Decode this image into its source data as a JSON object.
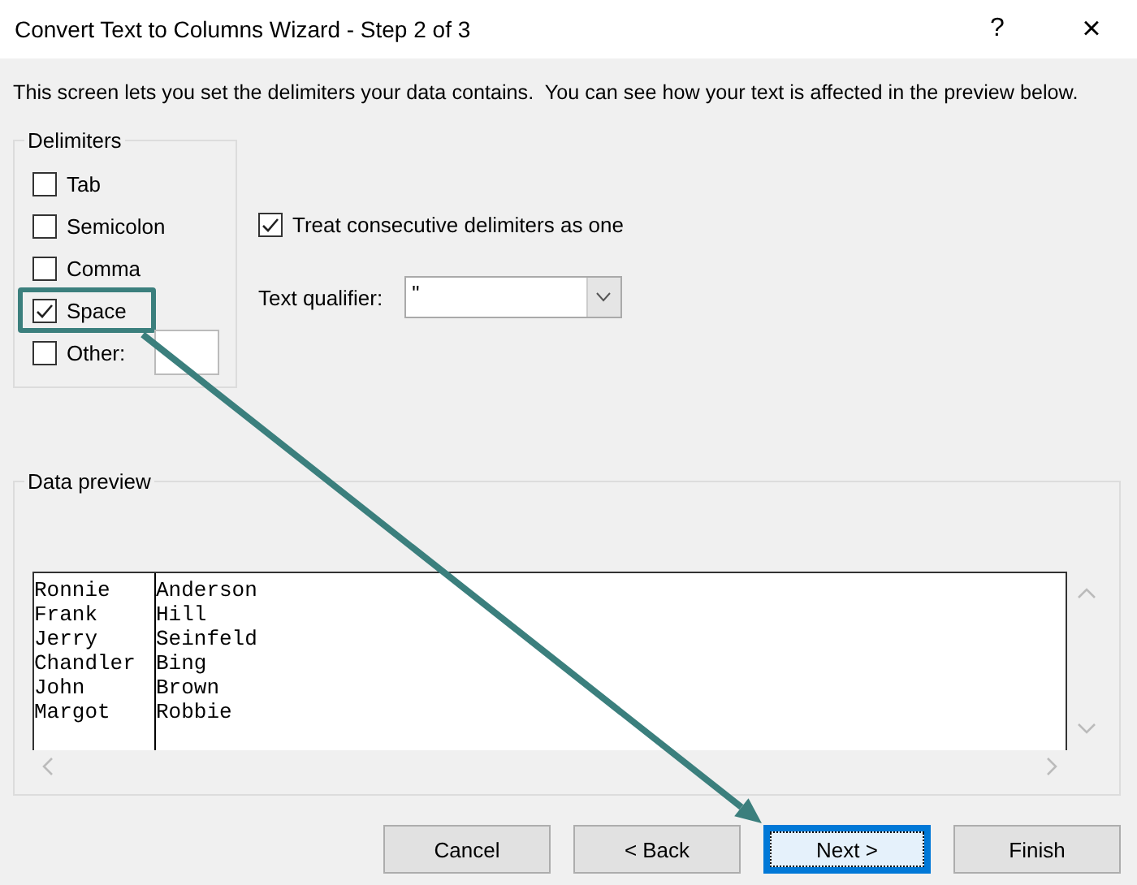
{
  "window": {
    "title": "Convert Text to Columns Wizard - Step 2 of 3",
    "help": "?",
    "close": "×"
  },
  "description": "This screen lets you set the delimiters your data contains.  You can see how your text is affected in the preview below.",
  "delimiters": {
    "title": "Delimiters",
    "items": [
      {
        "kind": "check",
        "label": "Tab",
        "checked": false,
        "highlighted": false
      },
      {
        "kind": "check",
        "label": "Semicolon",
        "checked": false,
        "highlighted": false
      },
      {
        "kind": "check",
        "label": "Comma",
        "checked": false,
        "highlighted": false
      },
      {
        "kind": "check",
        "label": "Space",
        "checked": true,
        "highlighted": true
      },
      {
        "kind": "other",
        "label": "Other:",
        "checked": false,
        "highlighted": false
      }
    ]
  },
  "consecutive": {
    "label": "Treat consecutive delimiters as one",
    "checked": true
  },
  "text_qualifier": {
    "label": "Text qualifier:",
    "value": "\""
  },
  "preview": {
    "title": "Data preview",
    "rows": [
      [
        "Ronnie",
        "Anderson"
      ],
      [
        "Frank",
        "Hill"
      ],
      [
        "Jerry",
        "Seinfeld"
      ],
      [
        "Chandler",
        "Bing"
      ],
      [
        "John",
        "Brown"
      ],
      [
        "Margot",
        "Robbie"
      ]
    ]
  },
  "buttons": [
    {
      "label": "Cancel",
      "default": false,
      "highlighted": false
    },
    {
      "label": "< Back",
      "default": false,
      "highlighted": false
    },
    {
      "label": "Next >",
      "default": true,
      "highlighted": true
    },
    {
      "label": "Finish",
      "default": false,
      "highlighted": false
    }
  ]
}
